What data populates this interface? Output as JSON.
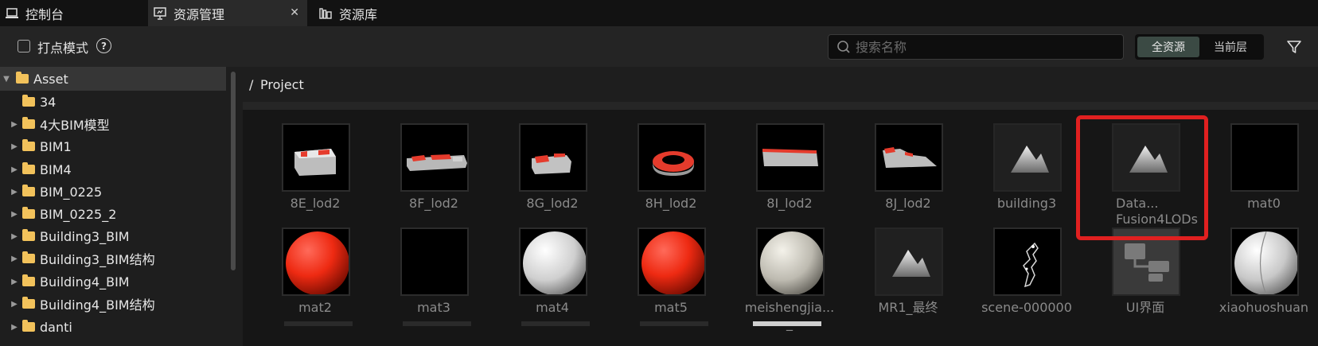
{
  "tabs": [
    {
      "label": "控制台",
      "icon": "laptop-icon"
    },
    {
      "label": "资源管理",
      "icon": "presentation-icon",
      "active": true
    },
    {
      "label": "资源库",
      "icon": "library-icon"
    }
  ],
  "toolbar": {
    "checkbox_label": "打点模式",
    "help": "?",
    "search_placeholder": "搜索名称",
    "scope_all": "全资源",
    "scope_current": "当前层"
  },
  "breadcrumb": {
    "separator": "/",
    "path": "Project"
  },
  "tree": [
    {
      "label": "Asset",
      "expanded": true,
      "selected": true
    },
    {
      "label": "34"
    },
    {
      "label": "4大BIM模型"
    },
    {
      "label": "BIM1"
    },
    {
      "label": "BIM4"
    },
    {
      "label": "BIM_0225"
    },
    {
      "label": "BIM_0225_2"
    },
    {
      "label": "Building3_BIM"
    },
    {
      "label": "Building3_BIM结构"
    },
    {
      "label": "Building4_BIM"
    },
    {
      "label": "Building4_BIM结构"
    },
    {
      "label": "danti"
    }
  ],
  "assets_row1": [
    {
      "name": "8E_lod2"
    },
    {
      "name": "8F_lod2"
    },
    {
      "name": "8G_lod2"
    },
    {
      "name": "8H_lod2"
    },
    {
      "name": "8I_lod2"
    },
    {
      "name": "8J_lod2"
    },
    {
      "name": "building3"
    },
    {
      "name": "Data...",
      "name2": "Fusion4LODs",
      "highlighted": true
    },
    {
      "name": "mat0"
    }
  ],
  "assets_row2": [
    {
      "name": "mat2"
    },
    {
      "name": "mat3"
    },
    {
      "name": "mat4"
    },
    {
      "name": "mat5"
    },
    {
      "name": "meishengjia...",
      "name2": "_"
    },
    {
      "name": "MR1_最终"
    },
    {
      "name": "scene-000000"
    },
    {
      "name": "UI界面"
    },
    {
      "name": "xiaohuoshuan"
    }
  ],
  "colors": {
    "accent_red": "#e02020",
    "folder": "#f2c25b",
    "scope_active": "#3b4a44"
  }
}
